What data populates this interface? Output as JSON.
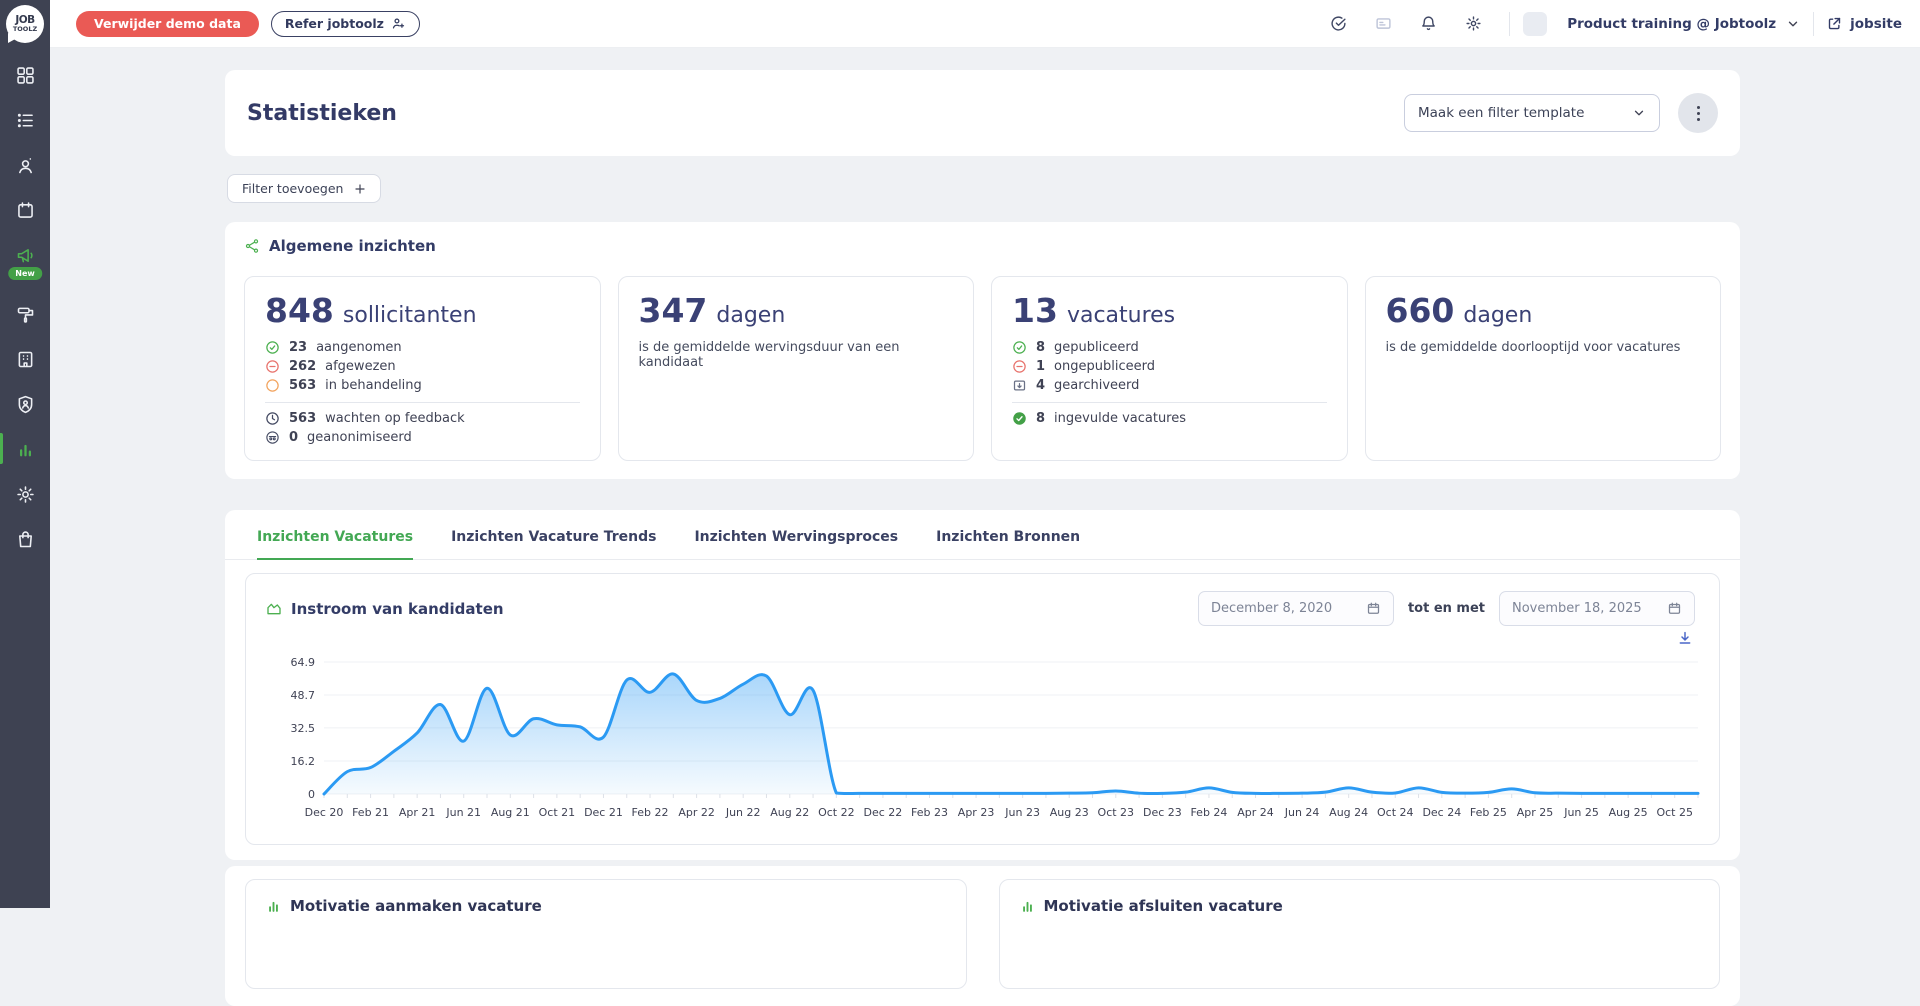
{
  "topbar": {
    "delete_demo_label": "Verwijder demo data",
    "refer_label": "Refer jobtoolz",
    "account_label": "Product training @ Jobtoolz",
    "jobsite_label": "jobsite"
  },
  "sidebar": {
    "logo_line1": "JOB",
    "logo_line2": "TOOLZ",
    "new_badge": "New"
  },
  "header": {
    "title": "Statistieken",
    "filter_template_placeholder": "Maak een filter template"
  },
  "filter_button": {
    "label": "Filter toevoegen"
  },
  "insights": {
    "title": "Algemene inzichten",
    "cards": [
      {
        "value": "848",
        "unit": "sollicitanten",
        "stats": [
          {
            "icon": "check-circle",
            "num": "23",
            "label": "aangenomen"
          },
          {
            "icon": "minus-circle",
            "num": "262",
            "label": "afgewezen"
          },
          {
            "icon": "circle",
            "num": "563",
            "label": "in behandeling"
          }
        ],
        "footer_stats": [
          {
            "icon": "clock",
            "num": "563",
            "label": "wachten op feedback"
          },
          {
            "icon": "anonymous",
            "num": "0",
            "label": "geanonimiseerd"
          }
        ]
      },
      {
        "value": "347",
        "unit": "dagen",
        "subtitle": "is de gemiddelde wervingsduur van een kandidaat"
      },
      {
        "value": "13",
        "unit": "vacatures",
        "stats": [
          {
            "icon": "check-circle",
            "num": "8",
            "label": "gepubliceerd"
          },
          {
            "icon": "minus-circle",
            "num": "1",
            "label": "ongepubliceerd"
          },
          {
            "icon": "archive",
            "num": "4",
            "label": "gearchiveerd"
          }
        ],
        "footer_stats": [
          {
            "icon": "check-solid",
            "num": "8",
            "label": "ingevulde vacatures"
          }
        ]
      },
      {
        "value": "660",
        "unit": "dagen",
        "subtitle": "is de gemiddelde doorlooptijd voor vacatures"
      }
    ]
  },
  "tabs": [
    {
      "label": "Inzichten Vacatures",
      "active": true
    },
    {
      "label": "Inzichten Vacature Trends",
      "active": false
    },
    {
      "label": "Inzichten Wervingsproces",
      "active": false
    },
    {
      "label": "Inzichten Bronnen",
      "active": false
    }
  ],
  "chart_card": {
    "title": "Instroom van kandidaten",
    "date_from": "December 8, 2020",
    "range_separator": "tot en met",
    "date_to": "November 18, 2025"
  },
  "chart_data": {
    "type": "area",
    "title": "Instroom van kandidaten",
    "xlabel": "",
    "ylabel": "",
    "ylim": [
      0,
      64.9
    ],
    "yticks": [
      64.9,
      48.7,
      32.5,
      16.2,
      0
    ],
    "grid": true,
    "line_color": "#2b9af3",
    "x": [
      "Dec 20",
      "Jan 21",
      "Feb 21",
      "Mar 21",
      "Apr 21",
      "May 21",
      "Jun 21",
      "Jul 21",
      "Aug 21",
      "Sep 21",
      "Oct 21",
      "Nov 21",
      "Dec 21",
      "Jan 22",
      "Feb 22",
      "Mar 22",
      "Apr 22",
      "May 22",
      "Jun 22",
      "Jul 22",
      "Aug 22",
      "Sep 22",
      "Oct 22",
      "Nov 22",
      "Dec 22",
      "Jan 23",
      "Feb 23",
      "Mar 23",
      "Apr 23",
      "May 23",
      "Jun 23",
      "Jul 23",
      "Aug 23",
      "Sep 23",
      "Oct 23",
      "Nov 23",
      "Dec 23",
      "Jan 24",
      "Feb 24",
      "Mar 24",
      "Apr 24",
      "May 24",
      "Jun 24",
      "Jul 24",
      "Aug 24",
      "Sep 24",
      "Oct 24",
      "Nov 24",
      "Dec 24",
      "Jan 25",
      "Feb 25",
      "Mar 25",
      "Apr 25",
      "May 25",
      "Jun 25",
      "Jul 25",
      "Aug 25",
      "Sep 25",
      "Oct 25",
      "Nov 25"
    ],
    "values": [
      0,
      11,
      13,
      21,
      30,
      44,
      26,
      52,
      29,
      37,
      34,
      33,
      28,
      56,
      50,
      59,
      46,
      47,
      54,
      58,
      39,
      51,
      0.5,
      0.3,
      0.3,
      0.3,
      0.3,
      0.3,
      0.3,
      0.3,
      0.3,
      0.3,
      0.4,
      0.6,
      1.5,
      0.4,
      0.3,
      0.9,
      3,
      0.8,
      0.3,
      0.3,
      0.4,
      0.9,
      3,
      0.9,
      0.5,
      3,
      0.8,
      0.4,
      0.8,
      2.5,
      0.6,
      0.4,
      0.3,
      0.3,
      0.3,
      0.3,
      0.3,
      0.3
    ]
  },
  "bottom_cards": [
    {
      "title": "Motivatie aanmaken vacature"
    },
    {
      "title": "Motivatie afsluiten vacature"
    }
  ]
}
